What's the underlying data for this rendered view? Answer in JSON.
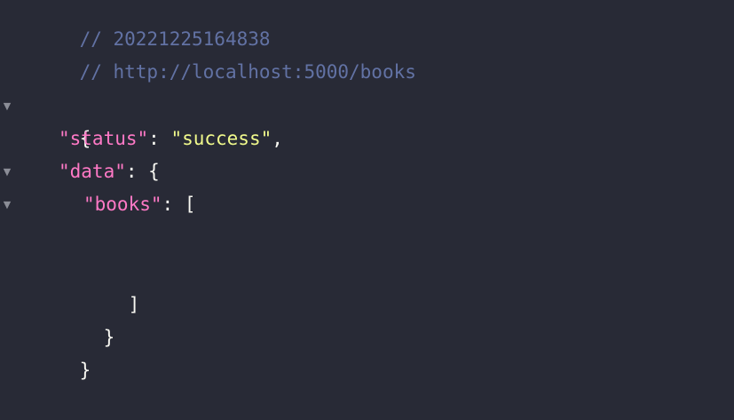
{
  "comments": {
    "timestamp": "// 20221225164838",
    "url": "// http://localhost:5000/books"
  },
  "json": {
    "open_root": "{",
    "status_key": "\"status\"",
    "status_sep": ": ",
    "status_value": "\"success\"",
    "status_comma": ",",
    "data_key": "\"data\"",
    "data_sep": ": ",
    "data_open": "{",
    "books_key": "\"books\"",
    "books_sep": ": ",
    "books_open": "[",
    "books_close": "]",
    "data_close": "}",
    "close_root": "}"
  },
  "toggles": {
    "glyph": "▼"
  },
  "colors": {
    "background": "#282a36",
    "comment": "#6272a4",
    "key": "#ff79c6",
    "string": "#f1fa8c",
    "punctuation": "#f8f8f2"
  }
}
